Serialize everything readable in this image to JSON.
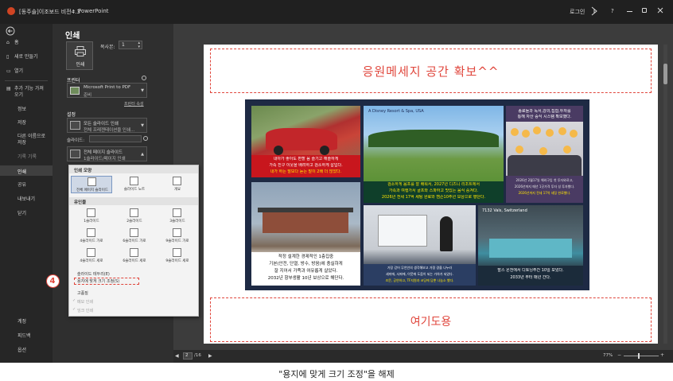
{
  "titlebar": {
    "doc_title": "[동주솔]이조보드 비전4.3",
    "separator": "-",
    "app_name": "PowerPoint",
    "login": "로그인",
    "help": "?"
  },
  "sidebar": {
    "home": "홈",
    "new": "새로 만들기",
    "open": "열기",
    "addin": "추가 기능 가져",
    "addin2": "오기",
    "info": "정보",
    "save": "저장",
    "saveas": "다른 이름으로",
    "saveas2": "저장",
    "history": "기록 기록",
    "print": "인쇄",
    "share": "공유",
    "export": "내보내기",
    "close": "닫기",
    "account": "계정",
    "feedback": "피드백",
    "options": "옵션"
  },
  "print_panel": {
    "heading": "인쇄",
    "print_button": "인쇄",
    "copies_label": "복사본:",
    "copies_value": "1",
    "printer_label": "프린터",
    "printer_name": "Microsoft Print to PDF",
    "printer_status": "준비",
    "printer_props": "프린터 속성",
    "settings_label": "설정",
    "setting1_line1": "모든 슬라이드 인쇄",
    "setting1_line2": "전체 프레젠테이션을 인쇄...",
    "slides_label": "슬라이드:",
    "setting2_line1": "전체 페이지 슬라이드",
    "setting2_line2": "1슬라이드/페이지 인쇄"
  },
  "popup": {
    "section_layout": "인쇄 모양",
    "layout_full": "전체 페이지 슬라이드",
    "layout_notes": "슬라이드 노트",
    "layout_outline": "개요",
    "section_handouts": "유인물",
    "handouts": [
      "1슬라이드",
      "2슬라이드",
      "3슬라이드",
      "4슬라이드 가로",
      "6슬라이드 가로",
      "9슬라이드 가로",
      "4슬라이드 세로",
      "6슬라이드 세로",
      "9슬라이드 세로"
    ],
    "frame": "슬라이드 테두리(E)",
    "fit_to_paper": "용지에 맞게 크기 조정(S)",
    "high_quality": "고품질",
    "print_comments": "메모 인쇄",
    "print_ink": "잉크 인쇄",
    "step_number": "4"
  },
  "slide": {
    "top_text": "응원메세지 공간 확보^^",
    "bottom_text": "여기도용"
  },
  "poster": {
    "panel1_line1": "내아가 좋아도 편할 음 즐기고 해졸하게",
    "panel1_line2": "가족 친구 이웃을 배려하고 검소하게 삽입다.",
    "panel1_line3": "내가 하는 말보다 듣는 말이 2배 더 많았다.",
    "panel2_heading": "A Disney Resort & Spa, USA",
    "panel2_line1": "검소하게 음프를 잘 배워서, 2027년 디즈니 리조트에서",
    "panel2_line2": "가족과 여행가서 골프와 스파하고 맛있는 음식 중겨다.",
    "panel2_line3": "2026년 전세 17억 세팅 완료와 캠슨10주년 보상으로 행단다.",
    "panel3_line1": "종료들과 독서,강의,집합,투자를",
    "panel3_line2": "통해 자산 증식 시스템 확보했다.",
    "panel3_line3": "2026년 2월17일 해외구입 첫 투자와료고,",
    "panel3_line4": "2026년까지 매년 1곳가격 투자 성 투자했다.",
    "panel3_line5": "2026년까지 전세 17억 세팅 완료했다.",
    "panel4_line1": "적정 설계한 경제적인 1층집중",
    "panel4_line2": "기본(안전, 단열, 방수, 방음)에 충실하게",
    "panel4_line3": "잘 지어서 가족과 여유롭게 살았다.",
    "panel4_line4": "2032년 항부생활 10년 보상으로 해단다.",
    "panel5_line1": "가장 갔어 무언인의 생각해보고 가정 경을 나누라",
    "panel5_line2": "세미에, 사파에, 이웃에 도움이 되는 가하가 되었다.",
    "panel5_line3": "조문, 공연하고, TF지원과 코딩에 담뿐 나눔소 했다.",
    "panel6_heading": "7132 Vals, Switzerland",
    "panel6_line1": "발스 온천에서 디토닝주간 10일 보냈다.",
    "panel6_line2": "2033년 부터 매년 간다."
  },
  "statusbar": {
    "page_current": "2",
    "page_total": "/16",
    "zoom": "77%"
  },
  "caption": "\"용지에 맞게 크기 조정\"을 해제"
}
